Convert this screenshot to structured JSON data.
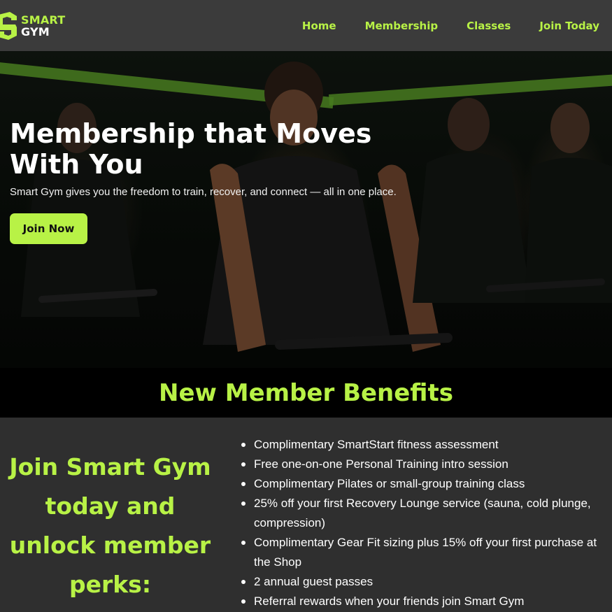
{
  "brand": {
    "line1": "SMART",
    "line2": "GYM",
    "accent": "#b8f246"
  },
  "nav": [
    {
      "label": "Home"
    },
    {
      "label": "Membership"
    },
    {
      "label": "Classes"
    },
    {
      "label": "Join Today"
    }
  ],
  "hero": {
    "title": "Membership that Moves With You",
    "subtitle": "Smart Gym gives you the freedom to train, recover, and connect — all in one place.",
    "cta": "Join Now"
  },
  "benefits": {
    "title": "New Member Benefits",
    "heading": "Join Smart Gym today and unlock member perks:",
    "items": [
      "Complimentary SmartStart fitness assessment",
      "Free one-on-one Personal Training intro session",
      "Complimentary Pilates or small-group training class",
      "25% off your first Recovery Lounge service (sauna, cold plunge, compression)",
      "Complimentary Gear Fit sizing plus 15% off your first purchase at the Shop",
      "2 annual guest passes",
      "Referral rewards when your friends join Smart Gym"
    ]
  }
}
